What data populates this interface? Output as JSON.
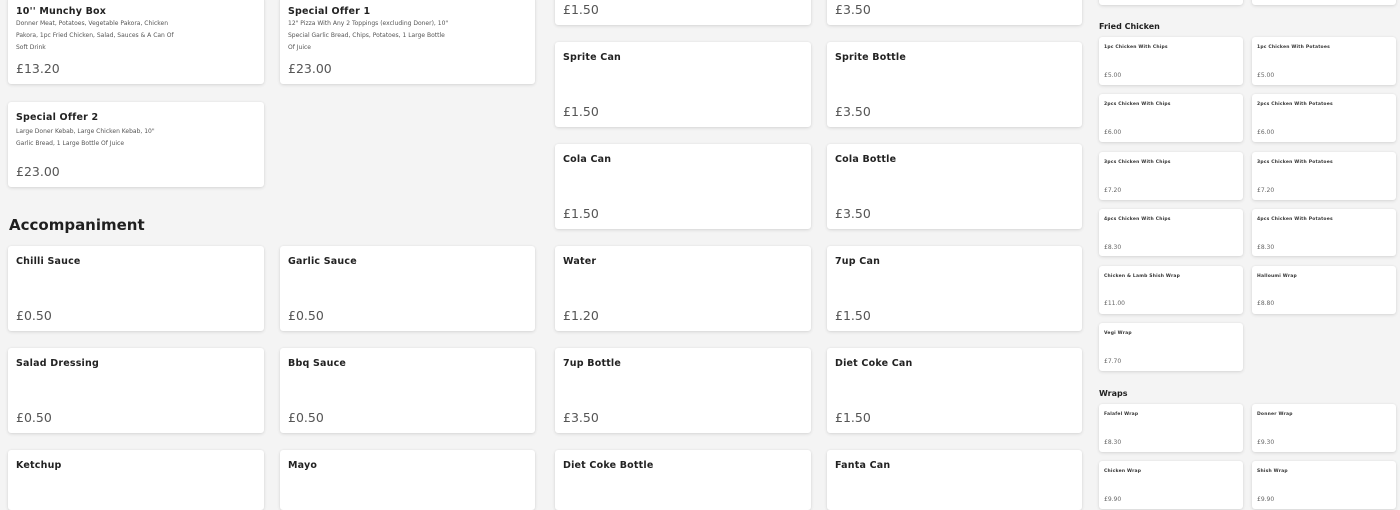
{
  "specials": [
    {
      "name": "10'' Munchy Box",
      "desc": "Donner Meat, Potatoes, Vegetable Pakora, Chicken Pakora, 1pc Fried Chicken, Salad, Sauces & A Can Of Soft Drink",
      "price": "£13.20"
    },
    {
      "name": "Special Offer 1",
      "desc": "12\" Pizza With Any 2 Toppings (excluding Doner), 10\" Special Garlic Bread, Chips, Potatoes, 1 Large Bottle Of Juice",
      "price": "£23.00"
    },
    {
      "name": "Special Offer 2",
      "desc": "Large Doner Kebab, Large Chicken Kebab, 10\" Garlic Bread, 1 Large Bottle Of Juice",
      "price": "£23.00"
    }
  ],
  "accompaniment": {
    "title": "Accompaniment",
    "items": [
      {
        "name": "Chilli Sauce",
        "price": "£0.50"
      },
      {
        "name": "Garlic Sauce",
        "price": "£0.50"
      },
      {
        "name": "Salad Dressing",
        "price": "£0.50"
      },
      {
        "name": "Bbq Sauce",
        "price": "£0.50"
      },
      {
        "name": "Ketchup",
        "price": ""
      },
      {
        "name": "Mayo",
        "price": ""
      }
    ]
  },
  "drinks": [
    {
      "name": "",
      "price": "£1.50"
    },
    {
      "name": "",
      "price": "£3.50"
    },
    {
      "name": "Sprite Can",
      "price": "£1.50"
    },
    {
      "name": "Sprite Bottle",
      "price": "£3.50"
    },
    {
      "name": "Cola Can",
      "price": "£1.50"
    },
    {
      "name": "Cola Bottle",
      "price": "£3.50"
    },
    {
      "name": "Water",
      "price": "£1.20"
    },
    {
      "name": "7up Can",
      "price": "£1.50"
    },
    {
      "name": "7up Bottle",
      "price": "£3.50"
    },
    {
      "name": "Diet Coke Can",
      "price": "£1.50"
    },
    {
      "name": "Diet Coke Bottle",
      "price": ""
    },
    {
      "name": "Fanta Can",
      "price": ""
    }
  ],
  "fried_chicken": {
    "title": "Fried Chicken",
    "items": [
      {
        "name": "1pc Chicken With Chips",
        "price": "£5.00"
      },
      {
        "name": "1pc Chicken With Potatoes",
        "price": "£5.00"
      },
      {
        "name": "2pcs Chicken With Chips",
        "price": "£6.00"
      },
      {
        "name": "2pcs Chicken With Potatoes",
        "price": "£6.00"
      },
      {
        "name": "3pcs Chicken With Chips",
        "price": "£7.20"
      },
      {
        "name": "3pcs Chicken With Potatoes",
        "price": "£7.20"
      },
      {
        "name": "4pcs Chicken With Chips",
        "price": "£8.30"
      },
      {
        "name": "4pcs Chicken With Potatoes",
        "price": "£8.30"
      },
      {
        "name": "Chicken & Lamb Shish Wrap",
        "price": "£11.00"
      },
      {
        "name": "Halloumi Wrap",
        "price": "£8.80"
      },
      {
        "name": "Vegi Wrap",
        "price": "£7.70"
      }
    ]
  },
  "wraps": {
    "title": "Wraps",
    "items": [
      {
        "name": "Falafel Wrap",
        "price": "£8.30"
      },
      {
        "name": "Donner Wrap",
        "price": "£9.30"
      },
      {
        "name": "Chicken Wrap",
        "price": "£9.90"
      },
      {
        "name": "Shish Wrap",
        "price": "£9.90"
      }
    ]
  }
}
